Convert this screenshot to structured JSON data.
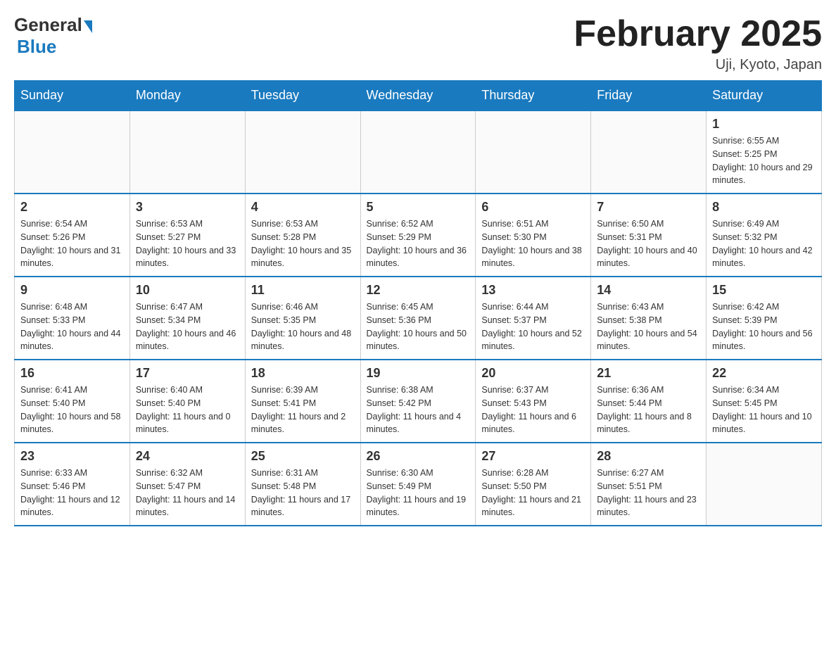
{
  "logo": {
    "text_general": "General",
    "text_blue": "Blue"
  },
  "header": {
    "month_title": "February 2025",
    "location": "Uji, Kyoto, Japan"
  },
  "weekdays": [
    "Sunday",
    "Monday",
    "Tuesday",
    "Wednesday",
    "Thursday",
    "Friday",
    "Saturday"
  ],
  "weeks": [
    [
      {
        "day": "",
        "info": ""
      },
      {
        "day": "",
        "info": ""
      },
      {
        "day": "",
        "info": ""
      },
      {
        "day": "",
        "info": ""
      },
      {
        "day": "",
        "info": ""
      },
      {
        "day": "",
        "info": ""
      },
      {
        "day": "1",
        "info": "Sunrise: 6:55 AM\nSunset: 5:25 PM\nDaylight: 10 hours and 29 minutes."
      }
    ],
    [
      {
        "day": "2",
        "info": "Sunrise: 6:54 AM\nSunset: 5:26 PM\nDaylight: 10 hours and 31 minutes."
      },
      {
        "day": "3",
        "info": "Sunrise: 6:53 AM\nSunset: 5:27 PM\nDaylight: 10 hours and 33 minutes."
      },
      {
        "day": "4",
        "info": "Sunrise: 6:53 AM\nSunset: 5:28 PM\nDaylight: 10 hours and 35 minutes."
      },
      {
        "day": "5",
        "info": "Sunrise: 6:52 AM\nSunset: 5:29 PM\nDaylight: 10 hours and 36 minutes."
      },
      {
        "day": "6",
        "info": "Sunrise: 6:51 AM\nSunset: 5:30 PM\nDaylight: 10 hours and 38 minutes."
      },
      {
        "day": "7",
        "info": "Sunrise: 6:50 AM\nSunset: 5:31 PM\nDaylight: 10 hours and 40 minutes."
      },
      {
        "day": "8",
        "info": "Sunrise: 6:49 AM\nSunset: 5:32 PM\nDaylight: 10 hours and 42 minutes."
      }
    ],
    [
      {
        "day": "9",
        "info": "Sunrise: 6:48 AM\nSunset: 5:33 PM\nDaylight: 10 hours and 44 minutes."
      },
      {
        "day": "10",
        "info": "Sunrise: 6:47 AM\nSunset: 5:34 PM\nDaylight: 10 hours and 46 minutes."
      },
      {
        "day": "11",
        "info": "Sunrise: 6:46 AM\nSunset: 5:35 PM\nDaylight: 10 hours and 48 minutes."
      },
      {
        "day": "12",
        "info": "Sunrise: 6:45 AM\nSunset: 5:36 PM\nDaylight: 10 hours and 50 minutes."
      },
      {
        "day": "13",
        "info": "Sunrise: 6:44 AM\nSunset: 5:37 PM\nDaylight: 10 hours and 52 minutes."
      },
      {
        "day": "14",
        "info": "Sunrise: 6:43 AM\nSunset: 5:38 PM\nDaylight: 10 hours and 54 minutes."
      },
      {
        "day": "15",
        "info": "Sunrise: 6:42 AM\nSunset: 5:39 PM\nDaylight: 10 hours and 56 minutes."
      }
    ],
    [
      {
        "day": "16",
        "info": "Sunrise: 6:41 AM\nSunset: 5:40 PM\nDaylight: 10 hours and 58 minutes."
      },
      {
        "day": "17",
        "info": "Sunrise: 6:40 AM\nSunset: 5:40 PM\nDaylight: 11 hours and 0 minutes."
      },
      {
        "day": "18",
        "info": "Sunrise: 6:39 AM\nSunset: 5:41 PM\nDaylight: 11 hours and 2 minutes."
      },
      {
        "day": "19",
        "info": "Sunrise: 6:38 AM\nSunset: 5:42 PM\nDaylight: 11 hours and 4 minutes."
      },
      {
        "day": "20",
        "info": "Sunrise: 6:37 AM\nSunset: 5:43 PM\nDaylight: 11 hours and 6 minutes."
      },
      {
        "day": "21",
        "info": "Sunrise: 6:36 AM\nSunset: 5:44 PM\nDaylight: 11 hours and 8 minutes."
      },
      {
        "day": "22",
        "info": "Sunrise: 6:34 AM\nSunset: 5:45 PM\nDaylight: 11 hours and 10 minutes."
      }
    ],
    [
      {
        "day": "23",
        "info": "Sunrise: 6:33 AM\nSunset: 5:46 PM\nDaylight: 11 hours and 12 minutes."
      },
      {
        "day": "24",
        "info": "Sunrise: 6:32 AM\nSunset: 5:47 PM\nDaylight: 11 hours and 14 minutes."
      },
      {
        "day": "25",
        "info": "Sunrise: 6:31 AM\nSunset: 5:48 PM\nDaylight: 11 hours and 17 minutes."
      },
      {
        "day": "26",
        "info": "Sunrise: 6:30 AM\nSunset: 5:49 PM\nDaylight: 11 hours and 19 minutes."
      },
      {
        "day": "27",
        "info": "Sunrise: 6:28 AM\nSunset: 5:50 PM\nDaylight: 11 hours and 21 minutes."
      },
      {
        "day": "28",
        "info": "Sunrise: 6:27 AM\nSunset: 5:51 PM\nDaylight: 11 hours and 23 minutes."
      },
      {
        "day": "",
        "info": ""
      }
    ]
  ]
}
